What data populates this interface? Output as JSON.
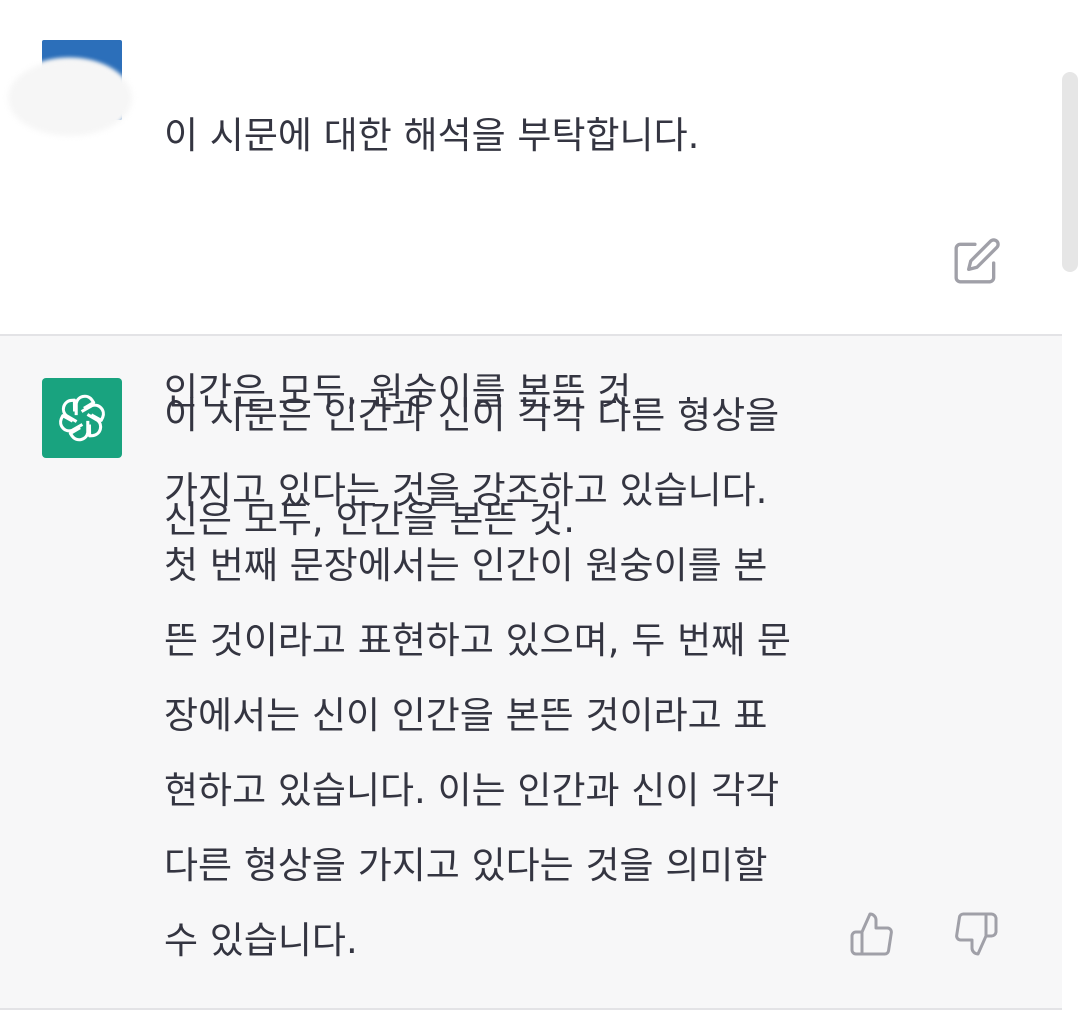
{
  "user_message": {
    "lines": [
      "이 시문에 대한 해석을 부탁합니다.",
      "",
      "인간은 모두, 원숭이를 본뜬 것.",
      "신은 모두, 인간을 본뜬 것."
    ]
  },
  "assistant_message": {
    "lines": [
      "이 시문은 인간과 신이 각각 다른 형상을",
      "가지고 있다는 것을 강조하고 있습니다.",
      "첫 번째 문장에서는 인간이 원숭이를 본",
      "뜬 것이라고 표현하고 있으며, 두 번째 문",
      "장에서는 신이 인간을 본뜬 것이라고 표",
      "현하고 있습니다. 이는 인간과 신이 각각",
      "다른 형상을 가지고 있다는 것을 의미할",
      "수 있습니다."
    ]
  },
  "icons": {
    "user_avatar": "user-avatar-image",
    "assistant_avatar": "openai-logo-icon",
    "edit": "edit-icon",
    "thumbs_up": "thumbs-up-icon",
    "thumbs_down": "thumbs-down-icon"
  },
  "colors": {
    "assistant_bg": "#f7f7f8",
    "user_bg": "#ffffff",
    "text": "#343541",
    "brand_green": "#19a37f",
    "icon_gray": "#a0a0a8"
  }
}
